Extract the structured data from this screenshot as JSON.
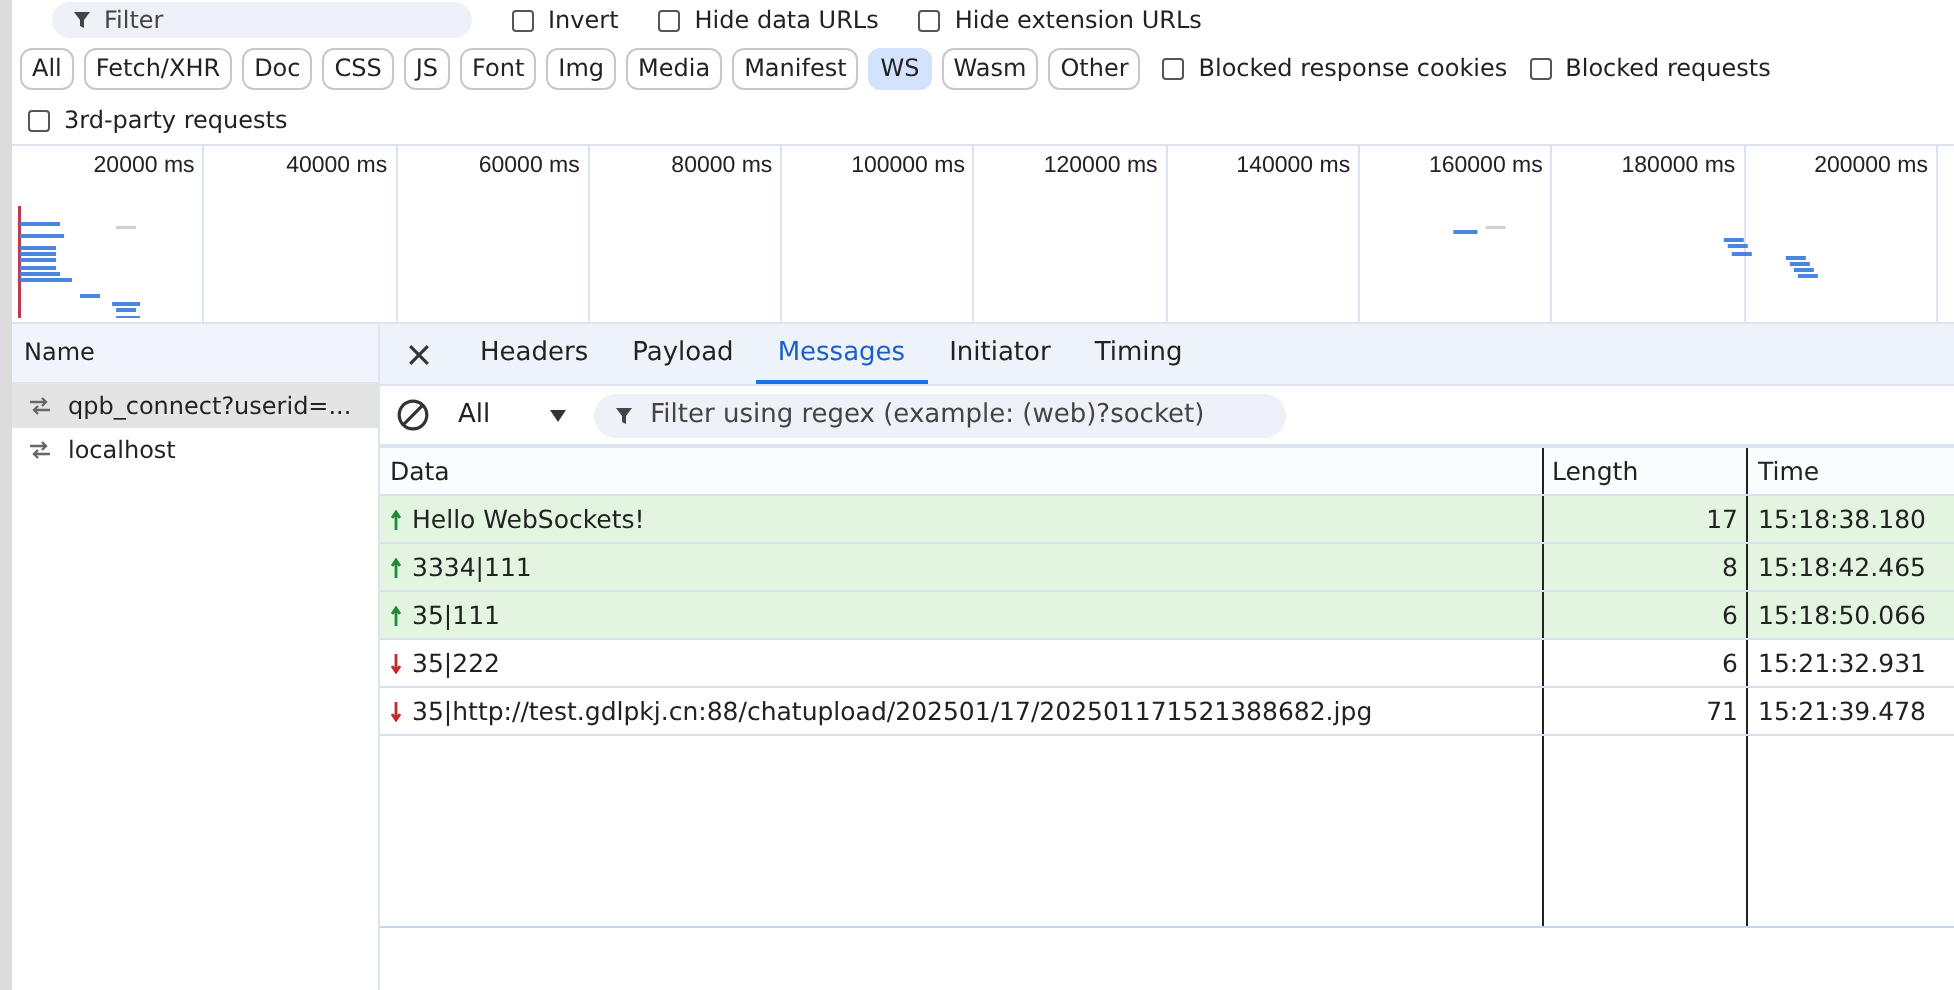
{
  "toolbar": {
    "filter": {
      "placeholder": "Filter"
    },
    "options": [
      {
        "label": "Invert",
        "checked": false
      },
      {
        "label": "Hide data URLs",
        "checked": false
      },
      {
        "label": "Hide extension URLs",
        "checked": false
      }
    ]
  },
  "type_filters": [
    {
      "label": "All",
      "selected": false
    },
    {
      "label": "Fetch/XHR",
      "selected": false
    },
    {
      "label": "Doc",
      "selected": false
    },
    {
      "label": "CSS",
      "selected": false
    },
    {
      "label": "JS",
      "selected": false
    },
    {
      "label": "Font",
      "selected": false
    },
    {
      "label": "Img",
      "selected": false
    },
    {
      "label": "Media",
      "selected": false
    },
    {
      "label": "Manifest",
      "selected": false
    },
    {
      "label": "WS",
      "selected": true
    },
    {
      "label": "Wasm",
      "selected": false
    },
    {
      "label": "Other",
      "selected": false
    }
  ],
  "blocked_options": [
    {
      "label": "Blocked response cookies",
      "checked": false
    },
    {
      "label": "Blocked requests",
      "checked": false
    }
  ],
  "third_party": {
    "label": "3rd-party requests",
    "checked": false
  },
  "timeline": {
    "ticks": [
      "20000 ms",
      "40000 ms",
      "60000 ms",
      "80000 ms",
      "100000 ms",
      "120000 ms",
      "140000 ms",
      "160000 ms",
      "180000 ms",
      "200000 ms"
    ]
  },
  "requests": {
    "header": "Name",
    "items": [
      {
        "name": "qpb_connect?userid=...",
        "selected": true
      },
      {
        "name": "localhost",
        "selected": false
      }
    ]
  },
  "detail_tabs": [
    {
      "label": "Headers",
      "selected": false
    },
    {
      "label": "Payload",
      "selected": false
    },
    {
      "label": "Messages",
      "selected": true
    },
    {
      "label": "Initiator",
      "selected": false
    },
    {
      "label": "Timing",
      "selected": false
    }
  ],
  "messages_toolbar": {
    "direction_filter": "All",
    "search": {
      "placeholder": "Filter using regex (example: (web)?socket)"
    }
  },
  "messages": {
    "columns": [
      "Data",
      "Length",
      "Time"
    ],
    "rows": [
      {
        "kind": "sent",
        "data": "Hello WebSockets!",
        "length": "17",
        "time": "15:18:38.180"
      },
      {
        "kind": "sent",
        "data": "3334|111",
        "length": "8",
        "time": "15:18:42.465"
      },
      {
        "kind": "sent",
        "data": "35|111",
        "length": "6",
        "time": "15:18:50.066"
      },
      {
        "kind": "received",
        "data": "35|222",
        "length": "6",
        "time": "15:21:32.931"
      },
      {
        "kind": "received",
        "data": "35|http://test.gdlpkj.cn:88/chatupload/202501/17/202501171521388682.jpg",
        "length": "71",
        "time": "15:21:39.478"
      }
    ]
  }
}
